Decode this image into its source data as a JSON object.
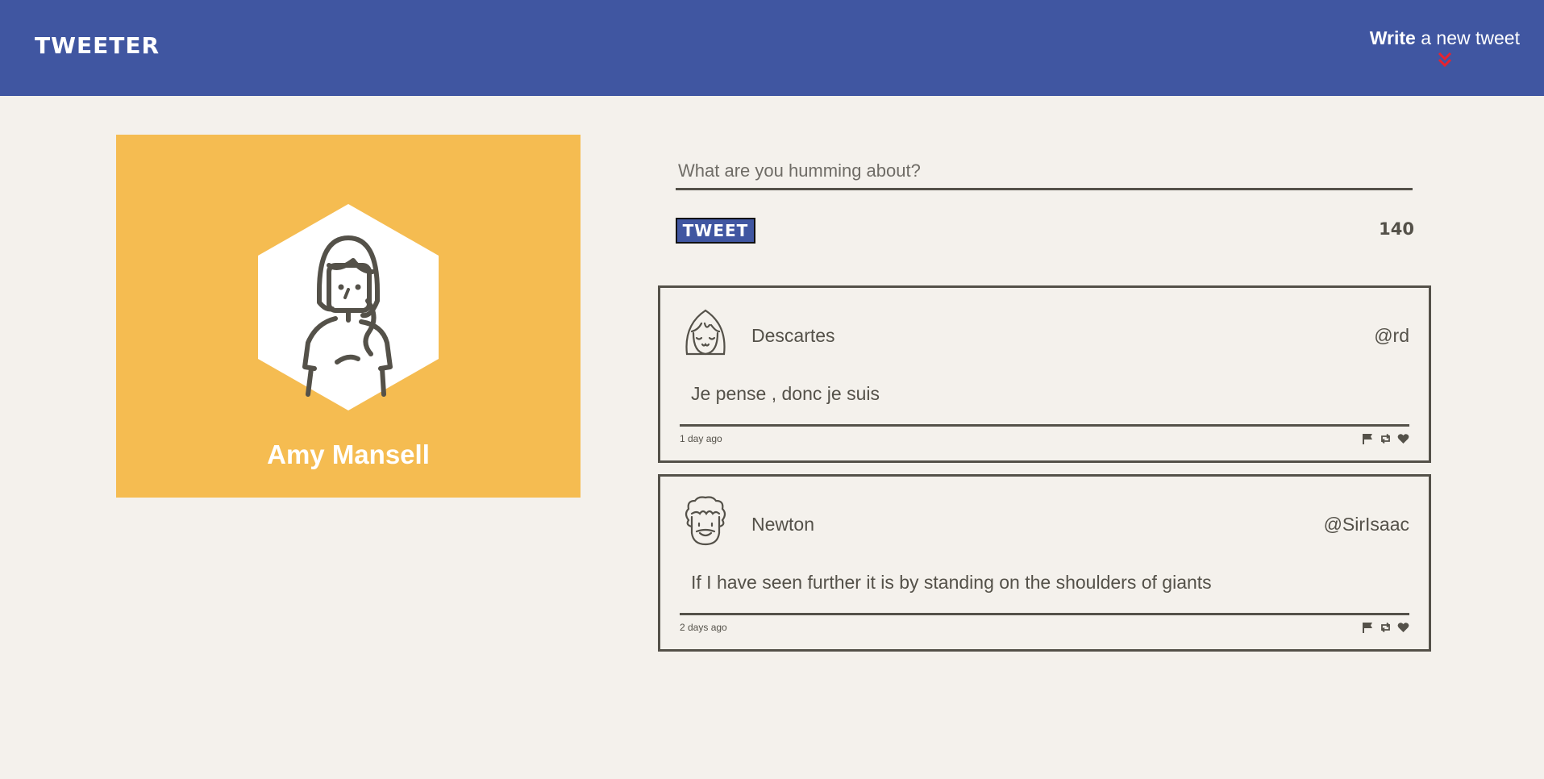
{
  "header": {
    "logo": "TWEETER",
    "compose_bold": "Write",
    "compose_rest": " a new tweet",
    "compose_icon": "double-chevron-down-icon",
    "accent_color": "#4056a1",
    "chevron_color": "#e8222e"
  },
  "profile": {
    "name": "Amy Mansell",
    "avatar_icon": "woman-avatar-icon",
    "card_color": "#f5bc51"
  },
  "composer": {
    "placeholder": "What are you humming about?",
    "button_label": "TWEET",
    "char_count": "140"
  },
  "tweets": [
    {
      "name": "Descartes",
      "handle": "@rd",
      "text": "Je pense , donc je suis",
      "age": "1 day ago",
      "avatar_icon": "smiling-girl-avatar-icon"
    },
    {
      "name": "Newton",
      "handle": "@SirIsaac",
      "text": "If I have seen further it is by standing on the shoulders of giants",
      "age": "2 days ago",
      "avatar_icon": "curly-hair-man-avatar-icon"
    }
  ],
  "tweet_actions": [
    "flag-icon",
    "retweet-icon",
    "heart-icon"
  ]
}
